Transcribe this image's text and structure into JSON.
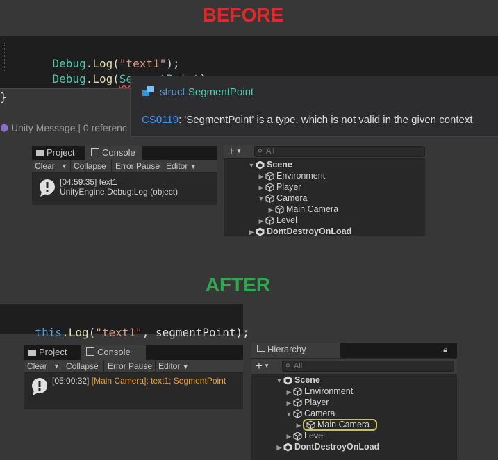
{
  "before": {
    "heading": "BEFORE",
    "heading_color": "#e02a2a",
    "code": {
      "line1": {
        "type": "Debug",
        "dot": ".",
        "method": "Log",
        "open": "(",
        "arg": "\"text1\"",
        "close": ");"
      },
      "line2": {
        "type": "Debug",
        "dot": ".",
        "method": "Log",
        "open": "(",
        "arg": "SegmentPoint",
        "close": ");"
      },
      "brace": "}",
      "codelens": "Unity Message | 0 referenc"
    },
    "tooltip": {
      "kind": "struct",
      "name": "SegmentPoint",
      "error_code": "CS0119",
      "error_text": ": 'SegmentPoint' is a type, which is not valid in the given context"
    },
    "console": {
      "tabs": [
        "Project",
        "Console"
      ],
      "toolbar": [
        "Clear",
        "Collapse",
        "Error Pause",
        "Editor"
      ],
      "entry": {
        "time": "[04:59:35] text1",
        "detail": "UnityEngine.Debug:Log (object)"
      }
    },
    "hierarchy": {
      "search_placeholder": "All",
      "rows": [
        {
          "label": "Scene",
          "depth": 0,
          "expanded": true,
          "scene": true
        },
        {
          "label": "Environment",
          "depth": 1,
          "expanded": false
        },
        {
          "label": "Player",
          "depth": 1,
          "expanded": false
        },
        {
          "label": "Camera",
          "depth": 1,
          "expanded": true
        },
        {
          "label": "Main Camera",
          "depth": 2,
          "expanded": false
        },
        {
          "label": "Level",
          "depth": 1,
          "expanded": false
        },
        {
          "label": "DontDestroyOnLoad",
          "depth": 0,
          "expanded": false,
          "scene": true
        }
      ]
    }
  },
  "after": {
    "heading": "AFTER",
    "heading_color": "#2fa84f",
    "code": {
      "kw": "this",
      "dot": ".",
      "method": "Log",
      "open": "(",
      "arg1": "\"text1\"",
      "comma": ", ",
      "arg2": "segmentPoint",
      "close": ");"
    },
    "console": {
      "tabs": [
        "Project",
        "Console"
      ],
      "toolbar": [
        "Clear",
        "Collapse",
        "Error Pause",
        "Editor"
      ],
      "entry": {
        "time": "[05:00:32]",
        "context": "[Main Camera]",
        "message": ": text1; SegmentPoint"
      }
    },
    "hierarchy": {
      "tab": "Hierarchy",
      "search_placeholder": "All",
      "rows": [
        {
          "label": "Scene",
          "depth": 0,
          "expanded": true,
          "scene": true
        },
        {
          "label": "Environment",
          "depth": 1,
          "expanded": false
        },
        {
          "label": "Player",
          "depth": 1,
          "expanded": false
        },
        {
          "label": "Camera",
          "depth": 1,
          "expanded": true
        },
        {
          "label": "Main Camera",
          "depth": 2,
          "expanded": false,
          "highlighted": true
        },
        {
          "label": "Level",
          "depth": 1,
          "expanded": false
        },
        {
          "label": "DontDestroyOnLoad",
          "depth": 0,
          "expanded": false,
          "scene": true
        }
      ]
    }
  }
}
